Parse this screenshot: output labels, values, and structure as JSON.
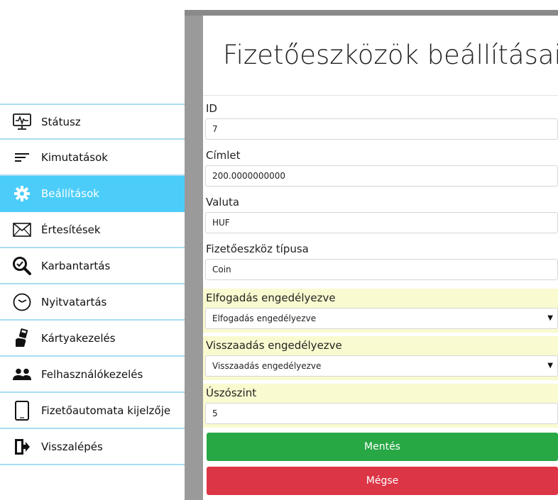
{
  "sidebar": {
    "items": [
      {
        "label": "Státusz",
        "icon": "monitor-pulse-icon",
        "active": false
      },
      {
        "label": "Kimutatások",
        "icon": "list-lines-icon",
        "active": false
      },
      {
        "label": "Beállítások",
        "icon": "gear-icon",
        "active": true
      },
      {
        "label": "Értesítések",
        "icon": "envelope-icon",
        "active": false
      },
      {
        "label": "Karbantartás",
        "icon": "magnifier-check-icon",
        "active": false
      },
      {
        "label": "Nyitvatartás",
        "icon": "clock-icon",
        "active": false
      },
      {
        "label": "Kártyakezelés",
        "icon": "card-hand-icon",
        "active": false
      },
      {
        "label": "Felhasználókezelés",
        "icon": "users-icon",
        "active": false
      },
      {
        "label": "Fizetőautomata kijelzője",
        "icon": "tablet-icon",
        "active": false
      },
      {
        "label": "Visszalépés",
        "icon": "exit-door-icon",
        "active": false
      }
    ]
  },
  "panel": {
    "title": "Fizetőeszközök beállításai",
    "fields": {
      "id": {
        "label": "ID",
        "value": "7"
      },
      "denomination": {
        "label": "Címlet",
        "value": "200.0000000000"
      },
      "currency": {
        "label": "Valuta",
        "value": "HUF"
      },
      "type": {
        "label": "Fizetőeszköz típusa",
        "value": "Coin"
      },
      "accept": {
        "label": "Elfogadás engedélyezve",
        "value": "Elfogadás engedélyezve"
      },
      "return": {
        "label": "Visszaadás engedélyezve",
        "value": "Visszaadás engedélyezve"
      },
      "float": {
        "label": "Úszószint",
        "value": "5"
      }
    },
    "save_label": "Mentés",
    "cancel_label": "Mégse"
  },
  "colors": {
    "active_bg": "#4ccdf9",
    "divider": "#a8dcf3",
    "highlight": "#fafad0",
    "save": "#28a745",
    "cancel": "#dc3545"
  }
}
